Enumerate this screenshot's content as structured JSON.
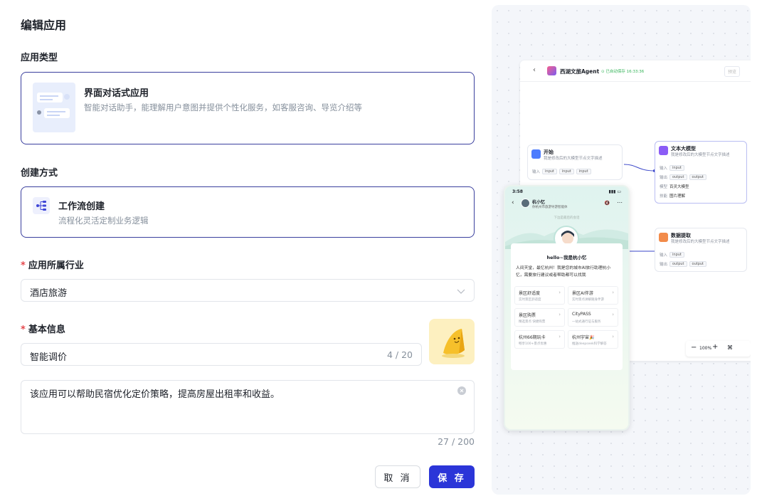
{
  "page": {
    "title": "编辑应用"
  },
  "app_type": {
    "label": "应用类型",
    "card_title": "界面对话式应用",
    "card_desc": "智能对话助手，能理解用户意图并提供个性化服务，如客服咨询、导览介绍等"
  },
  "create_method": {
    "label": "创建方式",
    "card_title": "工作流创建",
    "card_desc": "流程化灵活定制业务逻辑"
  },
  "industry": {
    "label": "应用所属行业",
    "value": "酒店旅游"
  },
  "basic_info": {
    "label": "基本信息",
    "name_value": "智能调价",
    "name_count": "4 / 20",
    "desc_value": "该应用可以帮助民宿优化定价策略，提高房屋出租率和收益。",
    "desc_count": "27 / 200"
  },
  "buttons": {
    "cancel": "取 消",
    "save": "保 存"
  },
  "colors": {
    "primary": "#2b35d8",
    "card_border": "#3a3f9e",
    "required": "#e5484d"
  },
  "preview": {
    "app_name": "西湖文旅Agent",
    "save_status": "已自动保存 16:33:36",
    "top_right": "预览",
    "start_node": {
      "title": "开始",
      "desc": "我是修改后的大模型节点文字描述",
      "input_label": "输入",
      "tags": [
        "input",
        "input",
        "input"
      ]
    },
    "llm_node": {
      "title": "文本大模型",
      "desc": "我是修改后的大模型节点文字描述",
      "input_label": "输入",
      "output_label": "输出",
      "model_label": "模型",
      "skill_label": "技能",
      "input_tag": "input",
      "output_tags": [
        "output",
        "output"
      ],
      "model": "百灵大模型",
      "skill": "图片理解"
    },
    "extract_node": {
      "title": "数据提取",
      "desc": "我是修改后的大模型节点文字描述",
      "input_label": "输入",
      "output_label": "输出",
      "input_tag": "input",
      "output_tags": [
        "output",
        "output"
      ]
    },
    "zoom": "100%",
    "phone": {
      "time": "3:58",
      "bot_name": "杭小忆",
      "bot_sub": "你杭州市旅游导游智能体",
      "notice": "下边是最后的会话",
      "greeting": "hello~我是杭小忆",
      "intro": "人间天堂，最忆杭州！我是您的城市AI旅行助理杭小忆，需要旅行建议或者帮助都可以找我",
      "grid": [
        {
          "title": "景区舒适度",
          "sub": "实时景区舒适度"
        },
        {
          "title": "景区AI伴游",
          "sub": "实时景点讲解随身伴游"
        },
        {
          "title": "景区购票",
          "sub": "精选景点 快捷购票"
        },
        {
          "title": "CityPASS",
          "sub": "一站式通行证与服务"
        },
        {
          "title": "杭州66期玩卡",
          "sub": "畅享100+景点优惠"
        },
        {
          "title": "杭州宇宙🎉",
          "sub": "推送deepseek科学解答"
        }
      ]
    }
  }
}
